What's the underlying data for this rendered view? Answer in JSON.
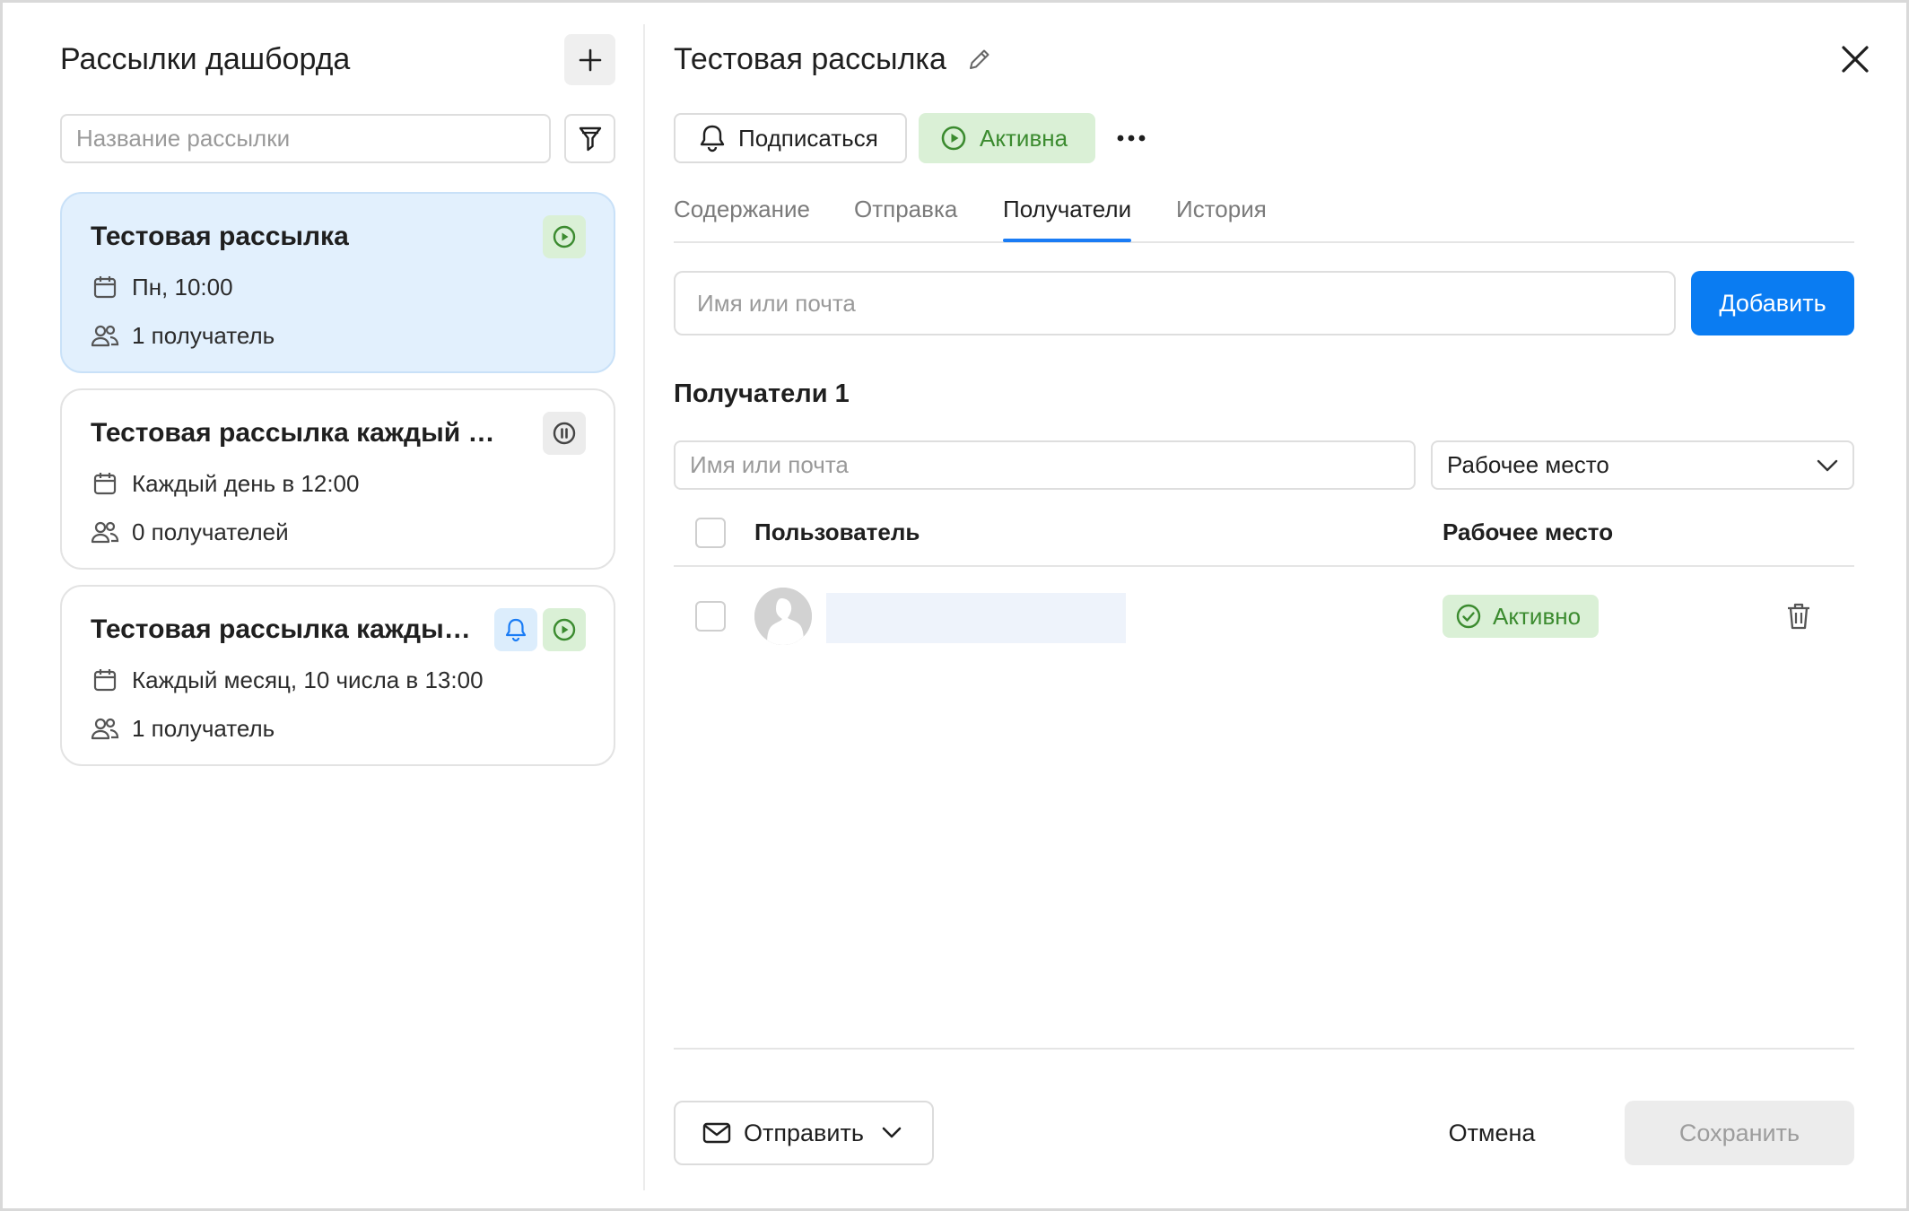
{
  "sidebar": {
    "title": "Рассылки дашборда",
    "search_placeholder": "Название рассылки",
    "items": [
      {
        "title": "Тестовая рассылка",
        "schedule": "Пн, 10:00",
        "recipients": "1 получатель",
        "status": "active",
        "selected": true
      },
      {
        "title": "Тестовая рассылка каждый день",
        "schedule": "Каждый день в 12:00",
        "recipients": "0 получателей",
        "status": "paused",
        "selected": false
      },
      {
        "title": "Тестовая рассылка каждый м...",
        "schedule": "Каждый месяц, 10 числа в 13:00",
        "recipients": "1 получатель",
        "status": "active",
        "subscribed": true,
        "selected": false
      }
    ]
  },
  "detail": {
    "title": "Тестовая рассылка",
    "subscribe_label": "Подписаться",
    "status_label": "Активна",
    "tabs": [
      {
        "label": "Содержание",
        "active": false
      },
      {
        "label": "Отправка",
        "active": false
      },
      {
        "label": "Получатели",
        "active": true
      },
      {
        "label": "История",
        "active": false
      }
    ],
    "recipient_input_placeholder": "Имя или почта",
    "add_button_label": "Добавить",
    "recipients_section_title": "Получатели 1",
    "filter_placeholder": "Имя или почта",
    "workspace_select_value": "Рабочее место",
    "table": {
      "columns": [
        "Пользователь",
        "Рабочее место"
      ],
      "rows": [
        {
          "user": "",
          "workspace_status": "Активно"
        }
      ]
    },
    "footer": {
      "send_label": "Отправить",
      "cancel_label": "Отмена",
      "save_label": "Сохранить"
    }
  },
  "colors": {
    "accent_blue": "#0a7cf2",
    "active_green_bg": "#daf0d6",
    "active_green_text": "#3b8b2f",
    "selected_card_bg": "#e2f0fd"
  },
  "icons": [
    "plus-icon",
    "filter-icon",
    "calendar-icon",
    "users-icon",
    "play-icon",
    "pause-icon",
    "bell-icon",
    "pencil-icon",
    "close-icon",
    "more-icon",
    "chevron-down-icon",
    "check-circle-icon",
    "trash-icon",
    "mail-icon"
  ]
}
